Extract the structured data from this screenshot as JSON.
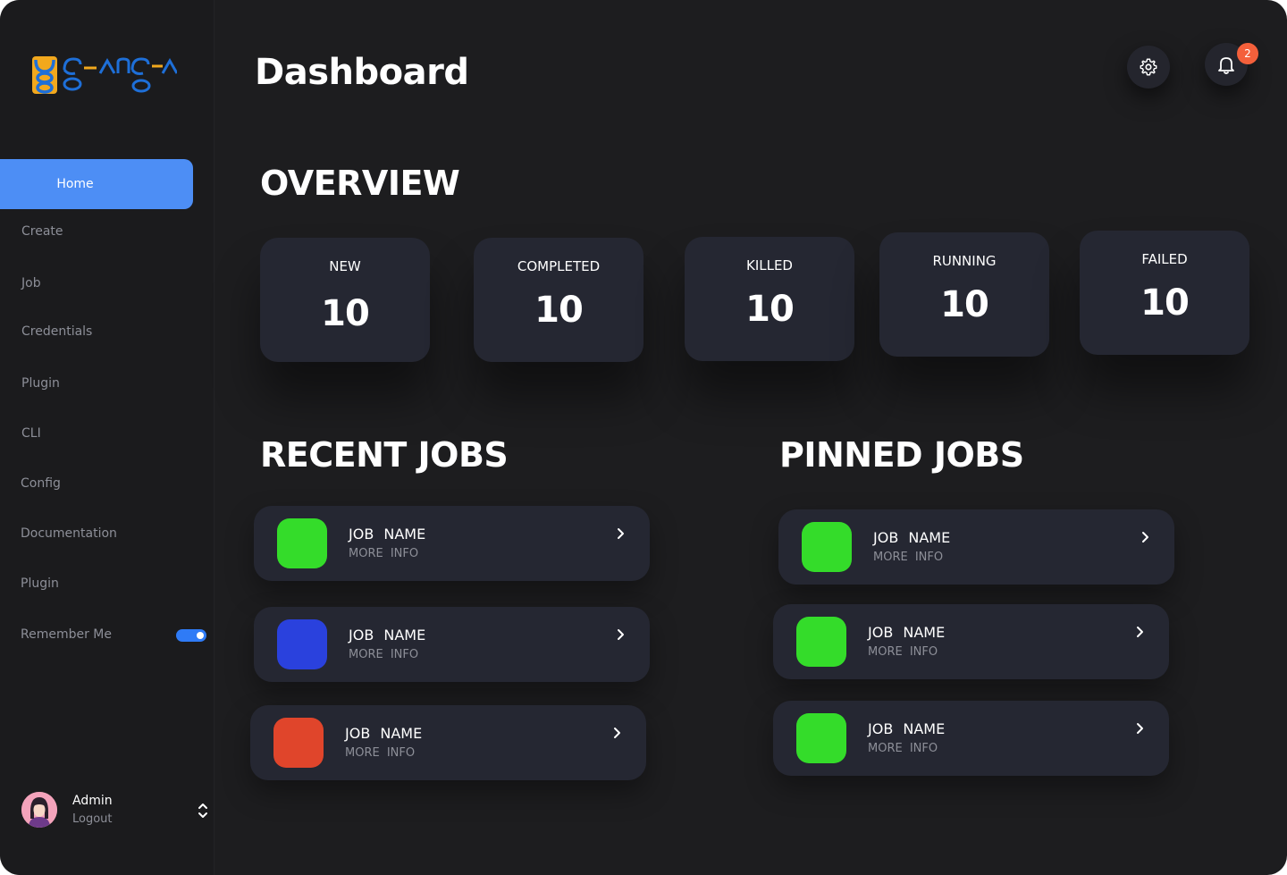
{
  "app": {
    "title": "Dashboard",
    "notification_count": "2"
  },
  "sidebar": {
    "items": [
      {
        "label": "Home",
        "active": true
      },
      {
        "label": "Create"
      },
      {
        "label": "Job"
      },
      {
        "label": "Credentials"
      },
      {
        "label": "Plugin"
      },
      {
        "label": "CLI"
      },
      {
        "label": "Config"
      },
      {
        "label": "Documentation"
      },
      {
        "label": "Plugin"
      }
    ],
    "remember_me": {
      "label": "Remember Me",
      "on": true
    },
    "user": {
      "name": "Admin",
      "action": "Logout"
    }
  },
  "overview": {
    "title": "OVERVIEW",
    "stats": [
      {
        "label": "NEW",
        "value": "10"
      },
      {
        "label": "COMPLETED",
        "value": "10"
      },
      {
        "label": "KILLED",
        "value": "10"
      },
      {
        "label": "RUNNING",
        "value": "10"
      },
      {
        "label": "FAILED",
        "value": "10"
      }
    ]
  },
  "recent_jobs": {
    "title": "RECENT JOBS",
    "items": [
      {
        "name": "JOB NAME",
        "info": "MORE INFO",
        "color": "#34dc2a"
      },
      {
        "name": "JOB NAME",
        "info": "MORE INFO",
        "color": "#2a41dd"
      },
      {
        "name": "JOB NAME",
        "info": "MORE INFO",
        "color": "#e0452b"
      }
    ]
  },
  "pinned_jobs": {
    "title": "PINNED JOBS",
    "items": [
      {
        "name": "JOB NAME",
        "info": "MORE INFO",
        "color": "#34dc2a"
      },
      {
        "name": "JOB NAME",
        "info": "MORE INFO",
        "color": "#34dc2a"
      },
      {
        "name": "JOB NAME",
        "info": "MORE INFO",
        "color": "#34dc2a"
      }
    ]
  },
  "colors": {
    "accent": "#4d8ef5",
    "badge": "#f4603b",
    "toggle": "#2f7bf6"
  },
  "icons": {
    "settings": "gear-icon",
    "notifications": "bell-icon",
    "chevron": "chevron-right-icon",
    "user_switch": "chevron-up-down-icon"
  }
}
